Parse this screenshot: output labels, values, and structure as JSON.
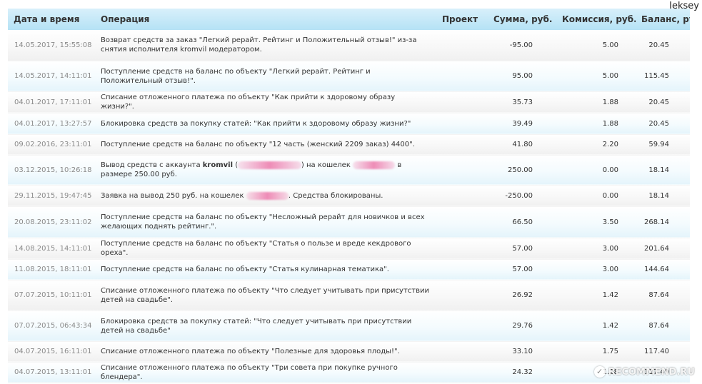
{
  "user": {
    "name": "Jeksey"
  },
  "table": {
    "headers": {
      "datetime": "Дата и время",
      "operation": "Операция",
      "project": "Проект",
      "amount": "Сумма, руб.",
      "fee": "Комиссия, руб.",
      "balance": "Баланс, руб."
    },
    "rows": [
      {
        "date": "14.05.2017, 15:55:08",
        "op": "Возврат средств за заказ \"Легкий рерайт. Рейтинг и Положительный отзыв!\" из-за снятия исполнителя kromvil модератором.",
        "project": "",
        "amount": "-95.00",
        "fee": "5.00",
        "balance": "20.45"
      },
      {
        "date": "14.05.2017, 14:11:01",
        "op": "Поступление средств на баланс по объекту \"Легкий рерайт. Рейтинг и Положительный отзыв!\".",
        "project": "",
        "amount": "95.00",
        "fee": "5.00",
        "balance": "115.45"
      },
      {
        "date": "04.01.2017, 17:11:01",
        "op": "Списание отложенного платежа по объекту \"Как прийти к здоровому образу жизни?\".",
        "project": "",
        "amount": "35.73",
        "fee": "1.88",
        "balance": "20.45"
      },
      {
        "date": "04.01.2017, 13:27:57",
        "op": "Блокировка средств за покупку статей: \"Как прийти к здоровому образу жизни?\"",
        "project": "",
        "amount": "39.49",
        "fee": "1.88",
        "balance": "20.45"
      },
      {
        "date": "09.02.2016, 23:11:01",
        "op": "Поступление средств на баланс по объекту \"12 часть (женский 2209 заказ) 4400\".",
        "project": "",
        "amount": "41.80",
        "fee": "2.20",
        "balance": "59.94"
      },
      {
        "date": "03.12.2015, 10:26:18",
        "op_parts": [
          "Вывод средств с аккаунта ",
          "kromvil",
          " (",
          "xxxxxxxxxxxxxxx",
          ") на кошелек ",
          "xxxxxxxxxx",
          " в размере 250.00 руб."
        ],
        "project": "",
        "amount": "250.00",
        "fee": "0.00",
        "balance": "18.14"
      },
      {
        "date": "29.11.2015, 19:47:45",
        "op_parts": [
          "Заявка на вывод 250 руб. на кошелек ",
          "xxxxxxxxxx",
          ". Средства блокированы."
        ],
        "project": "",
        "amount": "-250.00",
        "fee": "0.00",
        "balance": "18.14"
      },
      {
        "date": "20.08.2015, 23:11:02",
        "op": "Поступление средств на баланс по объекту \"Несложный рерайт для новичков и всех желающих поднять рейтинг.\".",
        "project": "",
        "amount": "66.50",
        "fee": "3.50",
        "balance": "268.14"
      },
      {
        "date": "14.08.2015, 14:11:01",
        "op": "Поступление средств на баланс по объекту \"Статья о пользе и вреде кекдрового ореха\".",
        "project": "",
        "amount": "57.00",
        "fee": "3.00",
        "balance": "201.64"
      },
      {
        "date": "11.08.2015, 18:11:01",
        "op": "Поступление средств на баланс по объекту \"Статья кулинарная тематика\".",
        "project": "",
        "amount": "57.00",
        "fee": "3.00",
        "balance": "144.64"
      },
      {
        "date": "07.07.2015, 10:11:01",
        "op": "Списание отложенного платежа по объекту \"Что следует учитывать при присутствии детей на свадьбе\".",
        "project": "",
        "amount": "26.92",
        "fee": "1.42",
        "balance": "87.64"
      },
      {
        "date": "07.07.2015, 06:43:34",
        "op": "Блокировка средств за покупку статей: \"Что следует учитывать при присутствии детей на свадьбе\"",
        "project": "",
        "amount": "29.76",
        "fee": "1.42",
        "balance": "87.64"
      },
      {
        "date": "04.07.2015, 16:11:01",
        "op": "Списание отложенного платежа по объекту \"Полезные для здоровья плоды!\".",
        "project": "",
        "amount": "33.10",
        "fee": "1.75",
        "balance": "117.40"
      },
      {
        "date": "04.07.2015, 13:11:01",
        "op": "Списание отложенного платежа по объекту \"Три совета при покупке ручного блендера\".",
        "project": "",
        "amount": "24.32",
        "fee": "1.28",
        "balance": "117.40"
      }
    ]
  },
  "watermark": {
    "text": "RECOMMEND.RU",
    "icon": "recommend-logo-icon"
  },
  "colors": {
    "header_top": "#d8f0fb",
    "header_bottom": "#b5e2f5",
    "row_gray": "#f0f0f0",
    "row_blue": "#e4f4fb",
    "redaction": "#ec78aa"
  }
}
